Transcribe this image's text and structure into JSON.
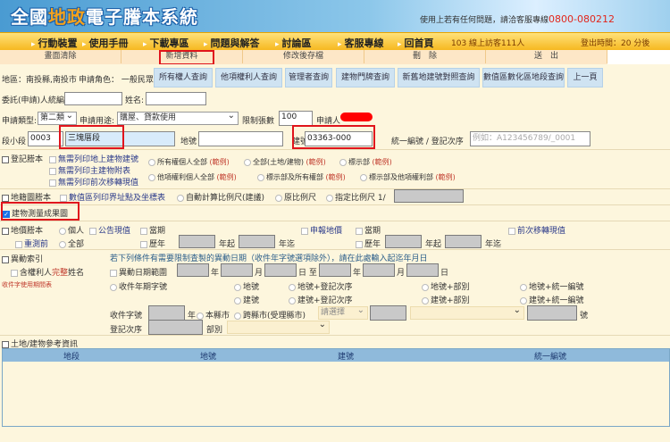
{
  "header": {
    "logo_part1": "全國",
    "logo_part2": "地政",
    "logo_part3": "電子謄本系統",
    "hotline_text": "使用上若有任何問題，請洽客服專線",
    "hotline_number": "0800-080212"
  },
  "nav": {
    "items": [
      "行動裝置",
      "使用手冊",
      "下載專區",
      "問題與解答",
      "討論區",
      "客服專線",
      "回首頁"
    ],
    "online": "103  線上訪客111人",
    "logout": "登出時間：20 分後"
  },
  "actions": [
    "畫面清除",
    "新增資料",
    "修改後存檔",
    "刪　除",
    "送　出"
  ],
  "info": {
    "region": "地區：南投縣,南投市",
    "role": "申請角色： 一般民眾"
  },
  "query_buttons": [
    "所有權人查詢",
    "他項權利人查詢",
    "管理者查詢",
    "建物門牌查詢",
    "新舊地建號對照查詢",
    "數值區數化區地段查詢",
    "上一頁"
  ],
  "form": {
    "client_id_label": "委託(申請)人統編:",
    "name_label": "姓名:",
    "apply_type_label": "申請類型:",
    "apply_type": "第二類",
    "purpose_label": "申請用途:",
    "purpose": "購屋、貸款使用",
    "limit_label": "限制張數",
    "limit": "100",
    "applicant_label": "申請人",
    "section_label": "段小段",
    "section_code": "0003",
    "section_name": "三塊厝段",
    "land_no_label": "地號",
    "land_no": "",
    "building_no_label": "建號",
    "building_no": "03363-000",
    "uid_label": "統一編號 / 登記次序",
    "uid_placeholder": "例如：A123456789/_0001"
  },
  "registration": {
    "label": "登記謄本",
    "opts": [
      "無需列印地上建物建號",
      "無需列印主建物附表",
      "無需列印前次移轉現值"
    ],
    "radios1": [
      "所有權個人全部",
      "全部(土地/建物)",
      "標示部"
    ],
    "radios2": [
      "他項權利個人全部",
      "標示部及所有權部",
      "標示部及他項權利部"
    ],
    "example": "(範例)"
  },
  "cadastral": {
    "label": "地籍圖謄本",
    "opt": "數值區列印界址點及坐標表",
    "r1": "自動計算比例尺(建議)",
    "r2": "原比例尺",
    "r3": "指定比例尺 1/"
  },
  "survey": {
    "label": "建物測量成果圖",
    "checked": true
  },
  "land_value": {
    "label": "地價謄本",
    "personal": "個人",
    "all": "全部",
    "remeasure": "重測前",
    "announced": "公告現值",
    "current": "當期",
    "history": "歷年",
    "year_from": "年起",
    "year_to": "年迄",
    "declared": "申報地價",
    "prev_transfer": "前次移轉現值"
  },
  "change_index": {
    "label": "異動索引",
    "full_name_pre": "含權利人",
    "full_name_hl": "完整",
    "full_name_post": "姓名",
    "table_link": "收件字使用期間表",
    "hint": "若下列條件有需要限制査製的異動日期（收件年字號選項除外），請在此處輸入起迄年月日",
    "date_range": "異動日期範圍",
    "y": "年",
    "m": "月",
    "d": "日",
    "to": "日 至",
    "r_receipt": "收件年期字號",
    "r": [
      "地號",
      "地號+登記次序",
      "地號+部別",
      "地號+統一編號",
      "建號",
      "建號+登記次序",
      "建號+部別",
      "建號+統一編號"
    ],
    "receipt_label": "收件字號",
    "year": "年",
    "this_county": "本縣市",
    "cross_county": "跨縣市(受理縣市)",
    "select_placeholder": "請選擇",
    "no": "號",
    "reg_order": "登記次序",
    "part": "部別"
  },
  "reference": {
    "label": "土地/建物參考資訊",
    "columns": [
      "地段",
      "地號",
      "建號",
      "統一編號"
    ]
  }
}
